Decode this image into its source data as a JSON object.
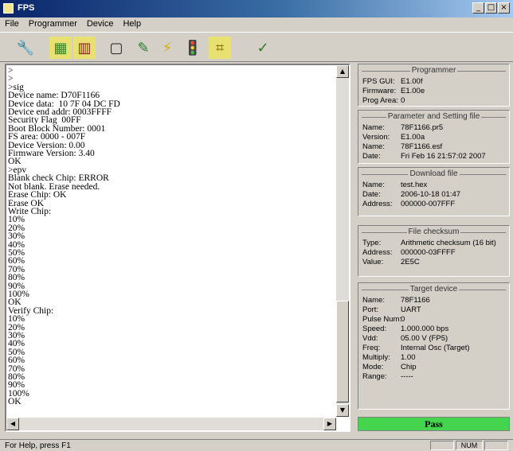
{
  "window": {
    "title": "FPS"
  },
  "menu": [
    {
      "label": "File"
    },
    {
      "label": "Programmer"
    },
    {
      "label": "Device"
    },
    {
      "label": "Help"
    }
  ],
  "toolbar": [
    {
      "icon": "wrench-icon",
      "glyph": "🔧"
    },
    {
      "icon": "chip-icon",
      "glyph": "▦"
    },
    {
      "icon": "binary-icon",
      "glyph": "▥"
    },
    {
      "icon": "blank-check-icon",
      "glyph": "▢"
    },
    {
      "icon": "program-pen-icon",
      "glyph": "✎"
    },
    {
      "icon": "lightning-icon",
      "glyph": "⚡"
    },
    {
      "icon": "traffic-light-icon",
      "glyph": "🚦"
    },
    {
      "icon": "checksum-icon",
      "glyph": "⌗"
    },
    {
      "icon": "verify-icon",
      "glyph": "✓"
    }
  ],
  "console": {
    "text": ">\n>\n>sig\nDevice name: D70F1166\nDevice data:  10 7F 04 DC FD\nDevice end addr: 0003FFFF\nSecurity Flag  00FF\nBoot Block Number: 0001\nFS area: 0000 - 007F\nDevice Version: 0.00\nFirmware Version: 3.40\nOK\n>epv\nBlank check Chip: ERROR\nNot blank. Erase needed.\nErase Chip: OK\nErase OK\nWrite Chip:\n10%\n20%\n30%\n40%\n50%\n60%\n70%\n80%\n90%\n100%\nOK\nVerify Chip:\n10%\n20%\n30%\n40%\n50%\n60%\n70%\n80%\n90%\n100%\nOK"
  },
  "programmer": {
    "title": "Programmer",
    "rows": [
      {
        "key": "FPS GUI:",
        "value": "E1.00f"
      },
      {
        "key": "Firmware:",
        "value": "E1.00e"
      },
      {
        "key": "Prog Area:",
        "value": "0"
      }
    ]
  },
  "parameter": {
    "title": "Parameter and Setting file",
    "rows": [
      {
        "key": "Name:",
        "value": "78F1166.pr5"
      },
      {
        "key": "Version:",
        "value": "E1.00a"
      },
      {
        "key": "Name:",
        "value": "78F1166.esf"
      },
      {
        "key": "Date:",
        "value": "Fri Feb 16 21:57:02 2007"
      }
    ]
  },
  "download": {
    "title": "Download file",
    "rows": [
      {
        "key": "Name:",
        "value": "test.hex"
      },
      {
        "key": "Date:",
        "value": "2006-10-18 01:47"
      },
      {
        "key": "Address:",
        "value": "000000-007FFF"
      }
    ]
  },
  "checksum": {
    "title": "File checksum",
    "rows": [
      {
        "key": "Type:",
        "value": "Arithmetic checksum (16 bit)"
      },
      {
        "key": "Address:",
        "value": "000000-03FFFF"
      },
      {
        "key": "Value:",
        "value": "2E5C"
      }
    ]
  },
  "target": {
    "title": "Target device",
    "rows": [
      {
        "key": "Name:",
        "value": "78F1166"
      },
      {
        "key": "Port:",
        "value": "UART"
      },
      {
        "key": "Pulse Num:",
        "value": "0"
      },
      {
        "key": "Speed:",
        "value": "1.000.000 bps"
      },
      {
        "key": "Vdd:",
        "value": "05.00 V (FP5)"
      },
      {
        "key": "Freq:",
        "value": "Internal Osc (Target)"
      },
      {
        "key": "Multiply:",
        "value": "1.00"
      },
      {
        "key": "Mode:",
        "value": "Chip"
      },
      {
        "key": "Range:",
        "value": "-----"
      }
    ]
  },
  "result": {
    "label": "Pass",
    "color": "#44d44e"
  },
  "status": {
    "text": "For Help, press F1",
    "num": "NUM"
  }
}
